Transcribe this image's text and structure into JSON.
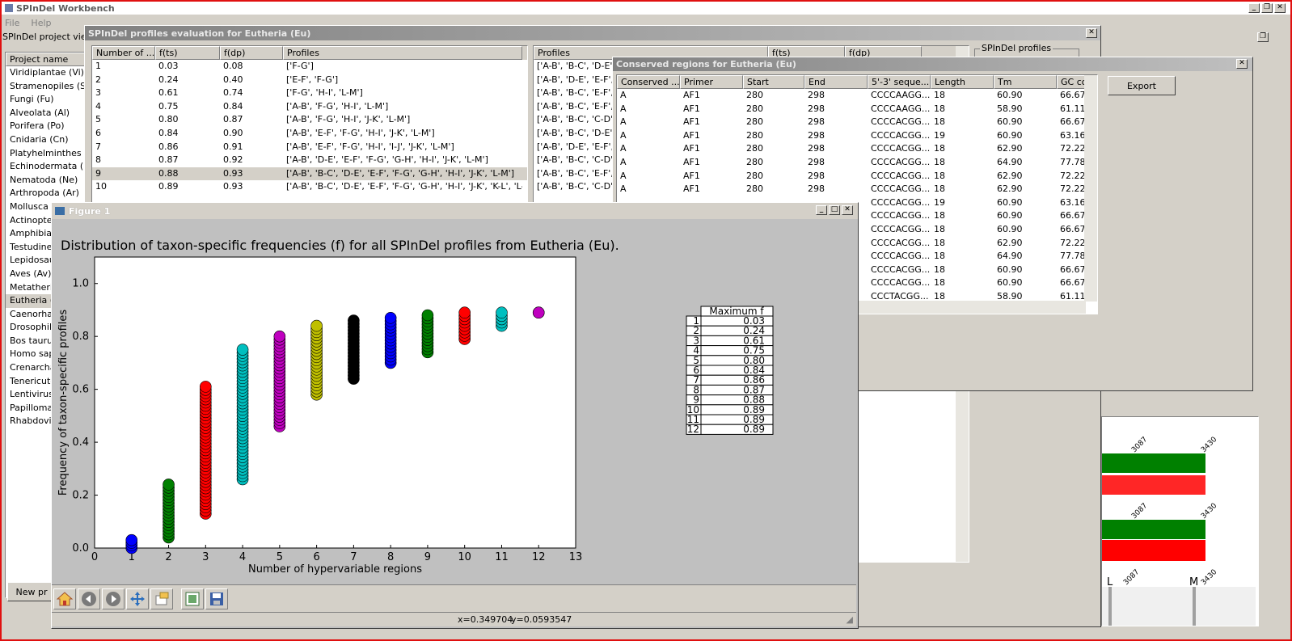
{
  "app": {
    "title": "SPInDel Workbench",
    "menu": [
      "File",
      "Help"
    ]
  },
  "project_viewer": {
    "title": "SPInDel project viewer",
    "column": "Project name",
    "items": [
      "Viridiplantae (Vi)",
      "Stramenopiles (St)",
      "Fungi (Fu)",
      "Alveolata (Al)",
      "Porifera (Po)",
      "Cnidaria (Cn)",
      "Platyhelminthes (Pl)",
      "Echinodermata (Ec)",
      "Nematoda (Ne)",
      "Arthropoda (Ar)",
      "Mollusca (M",
      "Actinopter",
      "Amphibia (",
      "Testudines",
      "Lepidosaur",
      "Aves (Av)",
      "Metatheria",
      "Eutheria (E",
      "Caenorhab",
      "Drosophila",
      "Bos taurus",
      "Homo sapi",
      "Crenarcha",
      "Tenericute",
      "Lentivirus",
      "Papillomav",
      "Rhabdoviri"
    ],
    "selected_index": 17,
    "new_button": "New pr"
  },
  "profiles_window": {
    "title": "SPInDel profiles evaluation for Eutheria (Eu)",
    "columns": [
      "Number of ...",
      "f(ts)",
      "f(dp)",
      "Profiles"
    ],
    "rows": [
      [
        "1",
        "0.03",
        "0.08",
        "['F-G']"
      ],
      [
        "2",
        "0.24",
        "0.40",
        "['E-F', 'F-G']"
      ],
      [
        "3",
        "0.61",
        "0.74",
        "['F-G', 'H-I', 'L-M']"
      ],
      [
        "4",
        "0.75",
        "0.84",
        "['A-B', 'F-G', 'H-I', 'L-M']"
      ],
      [
        "5",
        "0.80",
        "0.87",
        "['A-B', 'F-G', 'H-I', 'J-K', 'L-M']"
      ],
      [
        "6",
        "0.84",
        "0.90",
        "['A-B', 'E-F', 'F-G', 'H-I', 'J-K', 'L-M']"
      ],
      [
        "7",
        "0.86",
        "0.91",
        "['A-B', 'E-F', 'F-G', 'H-I', 'I-J', 'J-K', 'L-M']"
      ],
      [
        "8",
        "0.87",
        "0.92",
        "['A-B', 'D-E', 'E-F', 'F-G', 'G-H', 'H-I', 'J-K', 'L-M']"
      ],
      [
        "9",
        "0.88",
        "0.93",
        "['A-B', 'B-C', 'D-E', 'E-F', 'F-G', 'G-H', 'H-I', 'J-K', 'L-M']"
      ],
      [
        "10",
        "0.89",
        "0.93",
        "['A-B', 'B-C', 'D-E', 'E-F', 'F-G', 'G-H', 'H-I', 'J-K', 'K-L', 'L-M']"
      ]
    ],
    "selected_row": 8,
    "right_columns": [
      "Profiles",
      "f(ts)",
      "f(dp)"
    ],
    "right_rows": [
      "['A-B', 'B-C', 'D-E',",
      "['A-B', 'D-E', 'E-F',",
      "['A-B', 'B-C', 'E-F',",
      "['A-B', 'B-C', 'E-F',",
      "['A-B', 'B-C', 'C-D',",
      "['A-B', 'B-C', 'D-E',",
      "['A-B', 'D-E', 'E-F',",
      "['A-B', 'B-C', 'C-D',",
      "['A-B', 'B-C', 'E-F',",
      "['A-B', 'B-C', 'C-D',"
    ],
    "group_label": "SPInDel profiles",
    "export_button": "Export"
  },
  "conserved_window": {
    "title": "Conserved regions for Eutheria (Eu)",
    "columns": [
      "Conserved ...",
      "Primer",
      "Start",
      "End",
      "5'-3' seque...",
      "Length",
      "Tm",
      "GC co"
    ],
    "rows": [
      [
        "A",
        "AF1",
        "280",
        "298",
        "CCCCAAGG...",
        "18",
        "60.90",
        "66.67"
      ],
      [
        "A",
        "AF1",
        "280",
        "298",
        "CCCCAAGG...",
        "18",
        "58.90",
        "61.11"
      ],
      [
        "A",
        "AF1",
        "280",
        "298",
        "CCCCACGG...",
        "18",
        "60.90",
        "66.67"
      ],
      [
        "A",
        "AF1",
        "280",
        "298",
        "CCCCACGG...",
        "19",
        "60.90",
        "63.16"
      ],
      [
        "A",
        "AF1",
        "280",
        "298",
        "CCCCACGG...",
        "18",
        "62.90",
        "72.22"
      ],
      [
        "A",
        "AF1",
        "280",
        "298",
        "CCCCACGG...",
        "18",
        "64.90",
        "77.78"
      ],
      [
        "A",
        "AF1",
        "280",
        "298",
        "CCCCACGG...",
        "18",
        "62.90",
        "72.22"
      ],
      [
        "A",
        "AF1",
        "280",
        "298",
        "CCCCACGG...",
        "18",
        "62.90",
        "72.22"
      ],
      [
        "",
        "",
        "",
        "",
        "CCCCACGG...",
        "19",
        "60.90",
        "63.16"
      ],
      [
        "",
        "",
        "",
        "",
        "CCCCACGG...",
        "18",
        "60.90",
        "66.67"
      ],
      [
        "",
        "",
        "",
        "",
        "CCCCACGG...",
        "18",
        "60.90",
        "66.67"
      ],
      [
        "",
        "",
        "",
        "",
        "CCCCACGG...",
        "18",
        "62.90",
        "72.22"
      ],
      [
        "",
        "",
        "",
        "",
        "CCCCACGG...",
        "18",
        "64.90",
        "77.78"
      ],
      [
        "",
        "",
        "",
        "",
        "CCCCACGG...",
        "18",
        "60.90",
        "66.67"
      ],
      [
        "",
        "",
        "",
        "",
        "CCCCACGG...",
        "18",
        "60.90",
        "66.67"
      ],
      [
        "",
        "",
        "",
        "",
        "CCCTACGG...",
        "18",
        "58.90",
        "61.11"
      ]
    ]
  },
  "figure": {
    "title": "Figure 1",
    "status": {
      "x": "x=0.349704",
      "y": "y=0.0593547"
    },
    "table_header": "Maximum f",
    "table_rows": [
      [
        "1",
        "0.03"
      ],
      [
        "2",
        "0.24"
      ],
      [
        "3",
        "0.61"
      ],
      [
        "4",
        "0.75"
      ],
      [
        "5",
        "0.80"
      ],
      [
        "6",
        "0.84"
      ],
      [
        "7",
        "0.86"
      ],
      [
        "8",
        "0.87"
      ],
      [
        "9",
        "0.88"
      ],
      [
        "10",
        "0.89"
      ],
      [
        "11",
        "0.89"
      ],
      [
        "12",
        "0.89"
      ]
    ],
    "toolbar": [
      "home-icon",
      "back-icon",
      "forward-icon",
      "pan-icon",
      "zoom-icon",
      "subplots-icon",
      "save-icon"
    ]
  },
  "region_map": {
    "labels": [
      "3087",
      "3430",
      "3087",
      "3430",
      "L",
      "3087",
      "M",
      "3430"
    ]
  },
  "chart_data": {
    "type": "scatter",
    "title": "Distribution of taxon-specific frequencies (f) for all SPInDel profiles from Eutheria (Eu).",
    "xlabel": "Number of hypervariable regions",
    "ylabel": "Frequency of taxon-specific profiles",
    "xlim": [
      0,
      13
    ],
    "ylim": [
      0,
      1.1
    ],
    "xticks": [
      "0",
      "1",
      "2",
      "3",
      "4",
      "5",
      "6",
      "7",
      "8",
      "9",
      "10",
      "11",
      "12",
      "13"
    ],
    "yticks": [
      "0.0",
      "0.2",
      "0.4",
      "0.6",
      "0.8",
      "1.0"
    ],
    "grid": false,
    "series": [
      {
        "x": 1,
        "min": 0.0,
        "max": 0.03,
        "color": "#0000ff"
      },
      {
        "x": 2,
        "min": 0.04,
        "max": 0.24,
        "color": "#008000"
      },
      {
        "x": 3,
        "min": 0.13,
        "max": 0.61,
        "color": "#ff0000"
      },
      {
        "x": 4,
        "min": 0.26,
        "max": 0.75,
        "color": "#00bfbf"
      },
      {
        "x": 5,
        "min": 0.46,
        "max": 0.8,
        "color": "#bf00bf"
      },
      {
        "x": 6,
        "min": 0.58,
        "max": 0.84,
        "color": "#bfbf00"
      },
      {
        "x": 7,
        "min": 0.64,
        "max": 0.86,
        "color": "#000000"
      },
      {
        "x": 8,
        "min": 0.7,
        "max": 0.87,
        "color": "#0000ff"
      },
      {
        "x": 9,
        "min": 0.74,
        "max": 0.88,
        "color": "#008000"
      },
      {
        "x": 10,
        "min": 0.79,
        "max": 0.89,
        "color": "#ff0000"
      },
      {
        "x": 11,
        "min": 0.84,
        "max": 0.89,
        "color": "#00bfbf"
      },
      {
        "x": 12,
        "min": 0.89,
        "max": 0.89,
        "color": "#bf00bf"
      }
    ]
  }
}
